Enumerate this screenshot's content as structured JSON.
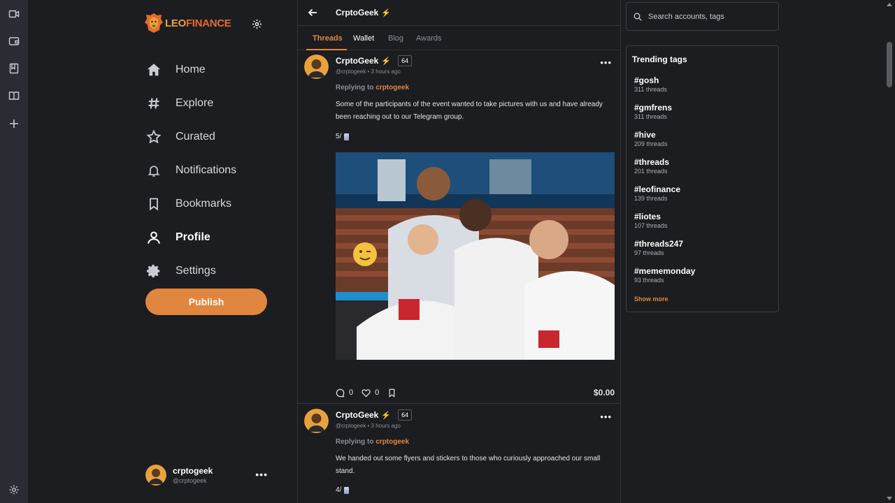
{
  "brand": {
    "part1": "LEO",
    "part2": "FINANCE"
  },
  "nav": {
    "items": [
      {
        "label": "Home",
        "icon": "home-icon"
      },
      {
        "label": "Explore",
        "icon": "hash-icon"
      },
      {
        "label": "Curated",
        "icon": "star-icon"
      },
      {
        "label": "Notifications",
        "icon": "bell-icon"
      },
      {
        "label": "Bookmarks",
        "icon": "bookmark-icon"
      },
      {
        "label": "Profile",
        "icon": "user-icon",
        "active": true
      },
      {
        "label": "Settings",
        "icon": "gear-icon"
      }
    ],
    "publish_label": "Publish"
  },
  "account": {
    "name": "crptogeek",
    "handle": "@crptogeek"
  },
  "profile": {
    "name": "CrptoGeek",
    "tabs": [
      "Threads",
      "Wallet",
      "Blog",
      "Awards"
    ],
    "active_tab": "Threads"
  },
  "posts": [
    {
      "author": "CrptoGeek",
      "rep": "64",
      "handle": "@crptogeek",
      "time": "3 hours ago",
      "replying_prefix": "Replying to",
      "replying_to": "crptogeek",
      "body": "Some of the participants of the event wanted to take pictures with us and have already been reaching out to our Telegram group.",
      "count": "5/",
      "comments": "0",
      "likes": "0",
      "amount": "$0.00"
    },
    {
      "author": "CrptoGeek",
      "rep": "64",
      "handle": "@crptogeek",
      "time": "3 hours ago",
      "replying_prefix": "Replying to",
      "replying_to": "crptogeek",
      "body": "We handed out some flyers and stickers to those who curiously approached our small stand.",
      "count": "4/"
    }
  ],
  "search": {
    "placeholder": "Search accounts, tags"
  },
  "trending": {
    "title": "Trending tags",
    "tags": [
      {
        "tag": "#gosh",
        "count": "311 threads"
      },
      {
        "tag": "#gmfrens",
        "count": "311 threads"
      },
      {
        "tag": "#hive",
        "count": "209 threads"
      },
      {
        "tag": "#threads",
        "count": "201 threads"
      },
      {
        "tag": "#leofinance",
        "count": "139 threads"
      },
      {
        "tag": "#liotes",
        "count": "107 threads"
      },
      {
        "tag": "#threads247",
        "count": "97 threads"
      },
      {
        "tag": "#mememonday",
        "count": "93 threads"
      }
    ],
    "show_more": "Show more"
  },
  "colors": {
    "accent": "#e0863e",
    "background": "#1c1d21",
    "rail": "#2a2c33",
    "bolt": "#f3c33b"
  }
}
